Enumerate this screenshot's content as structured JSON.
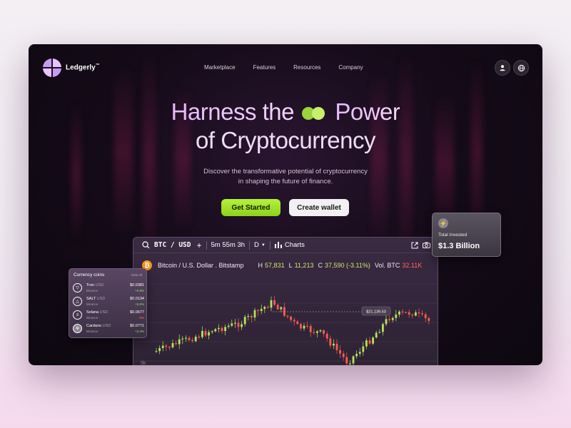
{
  "brand": {
    "name": "Ledgerly",
    "mark": "™"
  },
  "nav": {
    "items": [
      "Marketplace",
      "Features",
      "Resources",
      "Company"
    ]
  },
  "header_icons": [
    "user-icon",
    "globe-icon"
  ],
  "hero": {
    "line1_a": "Harness the",
    "line1_b": "Power",
    "line2": "of Cryptocurrency",
    "subtitle_1": "Discover the transformative potential of cryptocurrency",
    "subtitle_2": "in shaping the future of finance.",
    "cta_primary": "Get Started",
    "cta_secondary": "Create wallet"
  },
  "chart_panel": {
    "pair": "BTC / USD",
    "add": "+",
    "interval": "5m 55m 3h",
    "timeframe": "D",
    "charts_label": "Charts",
    "title": "Bitcoin / U.S. Dollar . Bitstamp",
    "high_label": "H",
    "high": "57,831",
    "low_label": "L",
    "low": "11,213",
    "close_label": "C",
    "close": "37,590 (-3.11%)",
    "vol_label": "Vol. BTC",
    "vol": "32.11K",
    "price_tag": "$21,139.53",
    "axis_label": "5k"
  },
  "coins_card": {
    "title": "Currency coins",
    "view_all": "View All",
    "items": [
      {
        "name": "Tron",
        "quote": "USD",
        "exchange": "Binance",
        "price": "$0.0381",
        "change": "+0.8%",
        "icon": "tron-icon"
      },
      {
        "name": "SALT",
        "quote": "USD",
        "exchange": "Binance",
        "price": "$0.0134",
        "change": "+5.8%",
        "icon": "salt-icon"
      },
      {
        "name": "Solana",
        "quote": "USD",
        "exchange": "Binance",
        "price": "$0.0677",
        "change": "-0%",
        "icon": "solana-icon"
      },
      {
        "name": "Cardano",
        "quote": "USD",
        "exchange": "Binance",
        "price": "$0.0771",
        "change": "+2.3%",
        "icon": "cardano-icon"
      }
    ]
  },
  "invest_card": {
    "label": "Total Invested",
    "value": "$1.3 Billion"
  },
  "colors": {
    "accent_green": "#a6e62a",
    "hero_pink": "#e9c6f2",
    "up": "#b6e35a",
    "down": "#ff5c4d"
  }
}
